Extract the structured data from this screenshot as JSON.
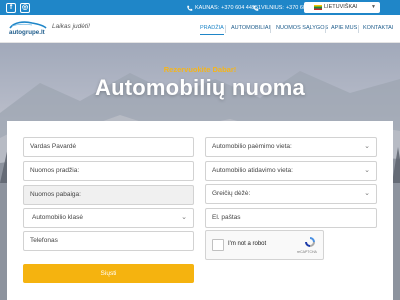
{
  "topbar": {
    "social": [
      "f",
      "◎"
    ],
    "contacts": [
      {
        "city": "KAUNAS:",
        "phone": "+370 604 44951"
      },
      {
        "city": "VILNIUS:",
        "phone": "+370 609 77888"
      }
    ],
    "language": "LIETUVIŠKAI"
  },
  "brand": {
    "logo_text": "autogrupe.lt",
    "slogan": "Laikas judėti!"
  },
  "nav": {
    "items": [
      "PRADŽIA",
      "AUTOMOBILIAI",
      "NUOMOS SĄLYGOS",
      "APIE MUS",
      "KONTAKTAI"
    ]
  },
  "hero": {
    "subtitle": "Rezervuokite Dabar!",
    "title": "Automobilių nuoma"
  },
  "form": {
    "name_placeholder": "Vardas Pavardė",
    "start_placeholder": "Nuomos pradžia:",
    "end_placeholder": "Nuomos pabaiga:",
    "car_class": "Automobilio klasė",
    "phone_placeholder": "Telefonas",
    "pickup_location": "Automobilio paėmimo vieta:",
    "return_location": "Automobilio atidavimo vieta:",
    "gearbox": "Greičių dėžė:",
    "email_placeholder": "El. paštas",
    "captcha_label": "I'm not a robot",
    "captcha_brand": "reCAPTCHA",
    "submit_label": "Siųsti"
  },
  "colors": {
    "brand_blue": "#1f86c8",
    "accent_yellow": "#f5b30f"
  }
}
